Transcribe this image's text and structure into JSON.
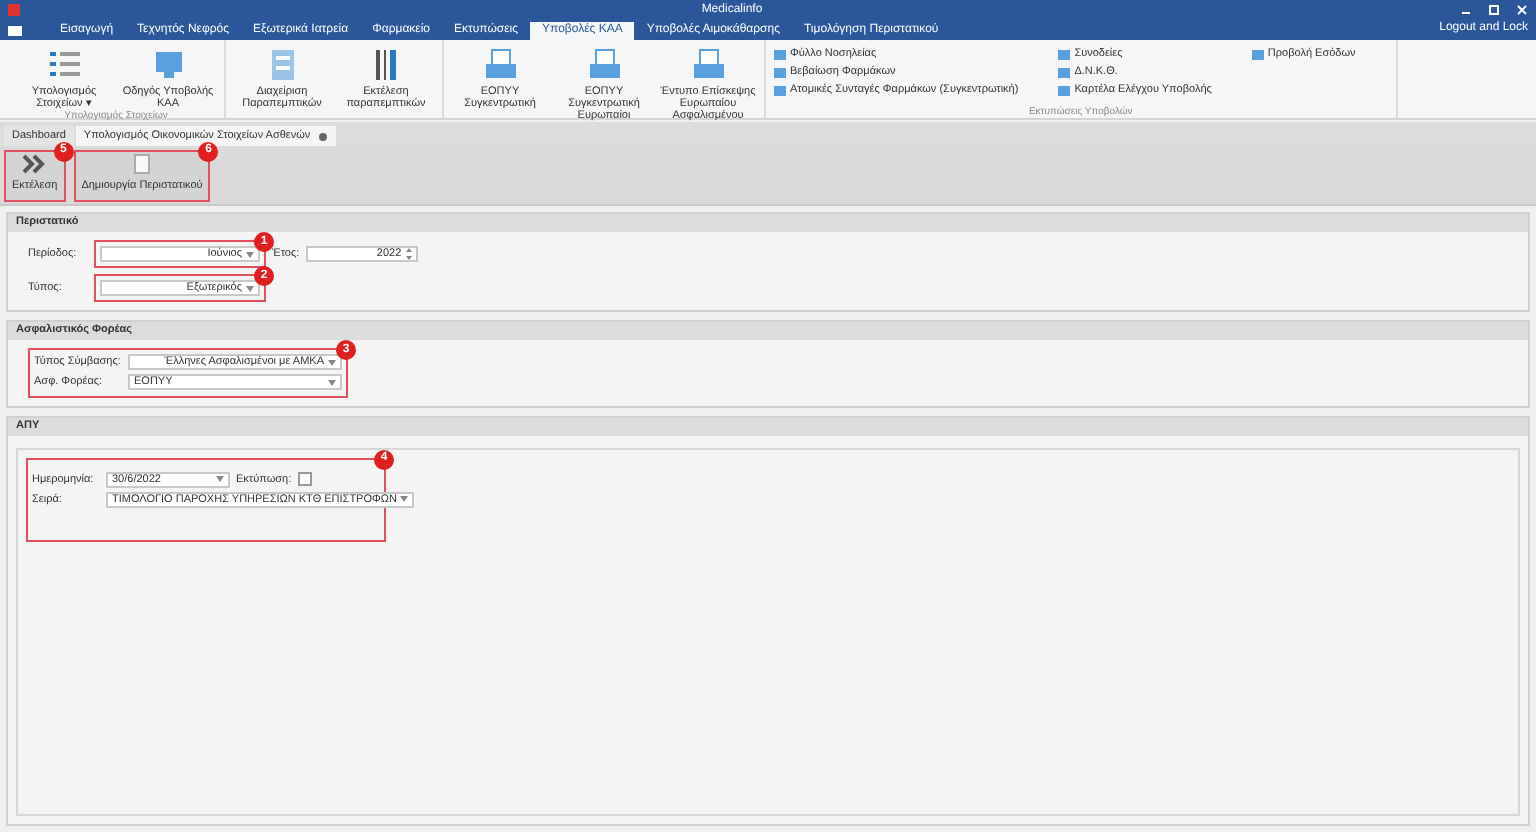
{
  "window": {
    "title": "Medicalinfo",
    "account": "Logout and Lock"
  },
  "menu_tabs": [
    {
      "label": "Εισαγωγή",
      "selected": false
    },
    {
      "label": "Τεχνητός Νεφρός",
      "selected": false
    },
    {
      "label": "Εξωτερικά Ιατρεία",
      "selected": false
    },
    {
      "label": "Φαρμακείο",
      "selected": false
    },
    {
      "label": "Εκτυπώσεις",
      "selected": false
    },
    {
      "label": "Υποβολές ΚΑΑ",
      "selected": true
    },
    {
      "label": "Υποβολές Αιμοκάθαρσης",
      "selected": false
    },
    {
      "label": "Τιμολόγηση Περιστατικού",
      "selected": false
    }
  ],
  "ribbon_groups": [
    {
      "label": "Υπολογισμός Στοιχείων",
      "large": [
        "Υπολογισμός Στοιχείων ▾",
        "Οδηγός Υποβολής ΚΑΑ"
      ]
    },
    {
      "large": [
        "Διαχείριση Παραπεμπτικών",
        "Εκτέλεση παραπεμπτικών"
      ]
    },
    {
      "large": [
        "ΕΟΠΥΥ Συγκεντρωτική",
        "ΕΟΠΥΥ Συγκεντρωτική Ευρωπαίοι",
        "Έντυπο Επίσκεψης Ευρωπαίου Ασφαλισμένου"
      ]
    },
    {
      "label": "Εκτυπώσεις Υποβολών",
      "small": [
        [
          "Φύλλο Νοσηλείας",
          "Βεβαίωση Φαρμάκων",
          "Ατομικές Συνταγές Φαρμάκων (Συγκεντρωτική)"
        ],
        [
          "Συνοδείες",
          "Δ.Ν.Κ.Θ.",
          "Καρτέλα Ελέγχου Υποβολής"
        ],
        [
          "Προβολή Εσόδων"
        ]
      ]
    }
  ],
  "document_tabs": [
    {
      "label": "Dashboard",
      "selected": false
    },
    {
      "label": "Υπολογισμός Οικονομικών Στοιχείων Ασθενών",
      "selected": true
    }
  ],
  "toolbar": [
    {
      "label": "Εκτέλεση",
      "callout": "5"
    },
    {
      "label": "Δημιουργία Περιστατικού",
      "callout": "6"
    }
  ],
  "sections": [
    {
      "title": "Περιστατικό",
      "groups": [
        {
          "callout": "1",
          "fields": [
            {
              "label": "Περίοδος:",
              "value": "Ιούνιος",
              "kind": "dropdown"
            }
          ]
        },
        {
          "callout": "2",
          "fields": [
            {
              "label": "Τύπος:",
              "value": "Εξωτερικός",
              "kind": "dropdown"
            }
          ]
        }
      ],
      "extra": {
        "label": "Έτος:",
        "value": "2022"
      }
    },
    {
      "title": "Ασφαλιστικός Φορέας",
      "groups": [
        {
          "callout": "3",
          "fields": [
            {
              "label": "Τύπος Σύμβασης:",
              "value": "Έλληνες Ασφαλισμένοι με ΑΜΚΑ",
              "kind": "dropdown"
            },
            {
              "label": "Ασφ. Φορέας:",
              "value": "ΕΟΠΥΥ",
              "kind": "dropdown_left"
            }
          ]
        }
      ]
    },
    {
      "title": "ΑΠΥ",
      "groups": [
        {
          "callout": "4",
          "fields": [
            {
              "label": "Ημερομηνία:",
              "value": "30/6/2022",
              "kind": "date",
              "check_label": "Εκτύπωση:",
              "checked": false
            },
            {
              "label": "Σειρά:",
              "value": "ΤΙΜΟΛΟΓΙΟ ΠΑΡΟΧΗΣ ΥΠΗΡΕΣΙΩΝ ΚΤΘ ΕΠΙΣΤΡΟΦΩΝ",
              "kind": "dropdown_left"
            }
          ]
        }
      ]
    }
  ]
}
